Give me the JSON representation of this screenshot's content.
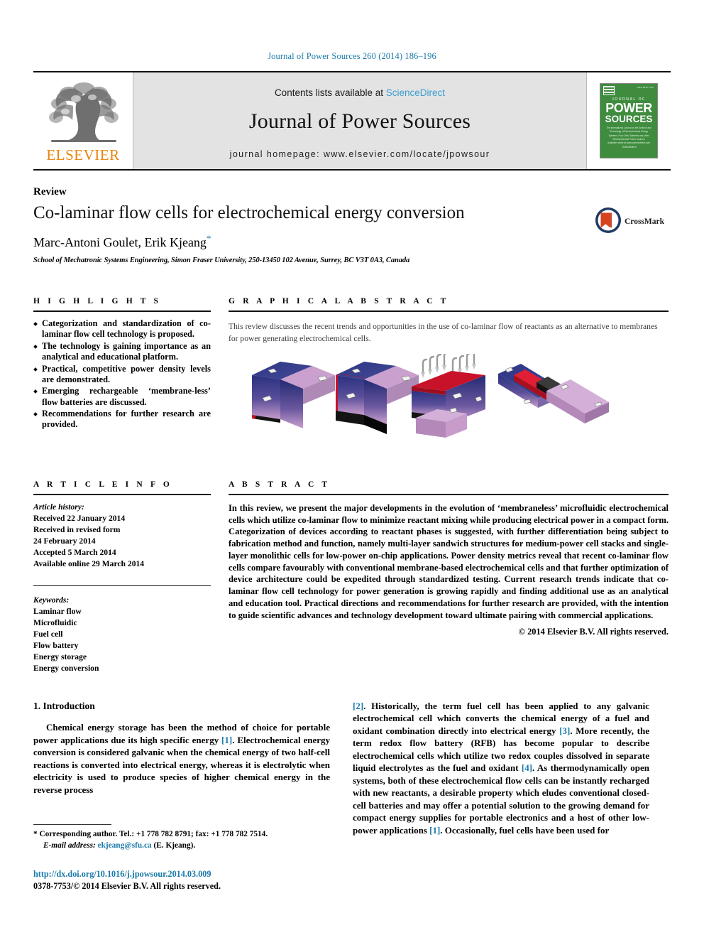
{
  "running_head": "Journal of Power Sources 260 (2014) 186–196",
  "masthead": {
    "contents_prefix": "Contents lists available at ",
    "sciencedirect": "ScienceDirect",
    "journal_name": "Journal of Power Sources",
    "homepage": "journal homepage: www.elsevier.com/locate/jpowsour",
    "publisher_wordmark": "ELSEVIER",
    "publisher_color": "#E8850C",
    "cover": {
      "issn": "ISSN 0378-7753",
      "journal_of": "JOURNAL OF",
      "power": "POWER",
      "sources": "SOURCES",
      "subtitle": "The International Journal on the Science and Technology of Electrochemical Energy Systems: Fuel Cells, Batteries and other Electrochemical Power Sources",
      "footer": "Available online at www.sciencedirect.com · ScienceDirect",
      "background_color": "#3f8c3f"
    }
  },
  "article": {
    "type": "Review",
    "title": "Co-laminar flow cells for electrochemical energy conversion",
    "authors": "Marc-Antoni Goulet, Erik Kjeang",
    "corresponding_marker": "*",
    "affiliation": "School of Mechatronic Systems Engineering, Simon Fraser University, 250-13450 102 Avenue, Surrey, BC V3T 0A3, Canada",
    "crossmark_label": "CrossMark"
  },
  "highlights": {
    "heading": "H I G H L I G H T S",
    "items": [
      "Categorization and standardization of co-laminar flow cell technology is proposed.",
      "The technology is gaining importance as an analytical and educational platform.",
      "Practical, competitive power density levels are demonstrated.",
      "Emerging rechargeable ‘membrane-less’ flow batteries are discussed.",
      "Recommendations for further research are provided."
    ]
  },
  "graphical_abstract": {
    "heading": "G R A P H I C A L   A B S T R A C T",
    "caption": "This review discusses the recent trends and opportunities in the use of co-laminar flow of reactants as an alternative to membranes for power generating electrochemical cells.",
    "figure_alt": "Four 3D schematic renderings of co-laminar flow cell architectures",
    "figure_colors": {
      "body_top": "#2b3580",
      "body_bottom": "#c49bc9",
      "accent_red": "#c8122a",
      "accent_black": "#111111",
      "electrode_grey": "#b9b9b9"
    }
  },
  "article_info": {
    "heading": "A R T I C L E   I N F O",
    "history_label": "Article history:",
    "history": [
      "Received 22 January 2014",
      "Received in revised form",
      "24 February 2014",
      "Accepted 5 March 2014",
      "Available online 29 March 2014"
    ],
    "keywords_label": "Keywords:",
    "keywords": [
      "Laminar flow",
      "Microfluidic",
      "Fuel cell",
      "Flow battery",
      "Energy storage",
      "Energy conversion"
    ]
  },
  "abstract": {
    "heading": "A B S T R A C T",
    "text": "In this review, we present the major developments in the evolution of ‘membraneless’ microfluidic electrochemical cells which utilize co-laminar flow to minimize reactant mixing while producing electrical power in a compact form. Categorization of devices according to reactant phases is suggested, with further differentiation being subject to fabrication method and function, namely multi-layer sandwich structures for medium-power cell stacks and single-layer monolithic cells for low-power on-chip applications. Power density metrics reveal that recent co-laminar flow cells compare favourably with conventional membrane-based electrochemical cells and that further optimization of device architecture could be expedited through standardized testing. Current research trends indicate that co-laminar flow cell technology for power generation is growing rapidly and finding additional use as an analytical and education tool. Practical directions and recommendations for further research are provided, with the intention to guide scientific advances and technology development toward ultimate pairing with commercial applications.",
    "copyright": "© 2014 Elsevier B.V. All rights reserved."
  },
  "body": {
    "section_number_title": "1. Introduction",
    "left_paragraph": "Chemical energy storage has been the method of choice for portable power applications due its high specific energy [1]. Electrochemical energy conversion is considered galvanic when the chemical energy of two half-cell reactions is converted into electrical energy, whereas it is electrolytic when electricity is used to produce species of higher chemical energy in the reverse process",
    "left_segments": [
      {
        "t": "Chemical energy storage has been the method of choice for portable power applications due its high specific energy ",
        "ref": false
      },
      {
        "t": "[1]",
        "ref": true
      },
      {
        "t": ". Electrochemical energy conversion is considered galvanic when the chemical energy of two half-cell reactions is converted into electrical energy, whereas it is electrolytic when electricity is used to produce species of higher chemical energy in the reverse process",
        "ref": false
      }
    ],
    "right_segments": [
      {
        "t": "[2]",
        "ref": true
      },
      {
        "t": ". Historically, the term fuel cell has been applied to any galvanic electrochemical cell which converts the chemical energy of a fuel and oxidant combination directly into electrical energy ",
        "ref": false
      },
      {
        "t": "[3]",
        "ref": true
      },
      {
        "t": ". More recently, the term redox flow battery (RFB) has become popular to describe electrochemical cells which utilize two redox couples dissolved in separate liquid electrolytes as the fuel and oxidant ",
        "ref": false
      },
      {
        "t": "[4]",
        "ref": true
      },
      {
        "t": ". As thermodynamically open systems, both of these electrochemical flow cells can be instantly recharged with new reactants, a desirable property which eludes conventional closed-cell batteries and may offer a potential solution to the growing demand for compact energy supplies for portable electronics and a host of other low-power applications ",
        "ref": false
      },
      {
        "t": "[1]",
        "ref": true
      },
      {
        "t": ". Occasionally, fuel cells have been used for",
        "ref": false
      }
    ]
  },
  "footer": {
    "corresponding_marker": "*",
    "corresponding_text": " Corresponding author. Tel.: +1 778 782 8791; fax: +1 778 782 7514.",
    "email_label": "E-mail address:",
    "email": "ekjeang@sfu.ca",
    "email_owner": "(E. Kjeang).",
    "doi": "http://dx.doi.org/10.1016/j.jpowsour.2014.03.009",
    "issn_copyright": "0378-7753/© 2014 Elsevier B.V. All rights reserved."
  }
}
